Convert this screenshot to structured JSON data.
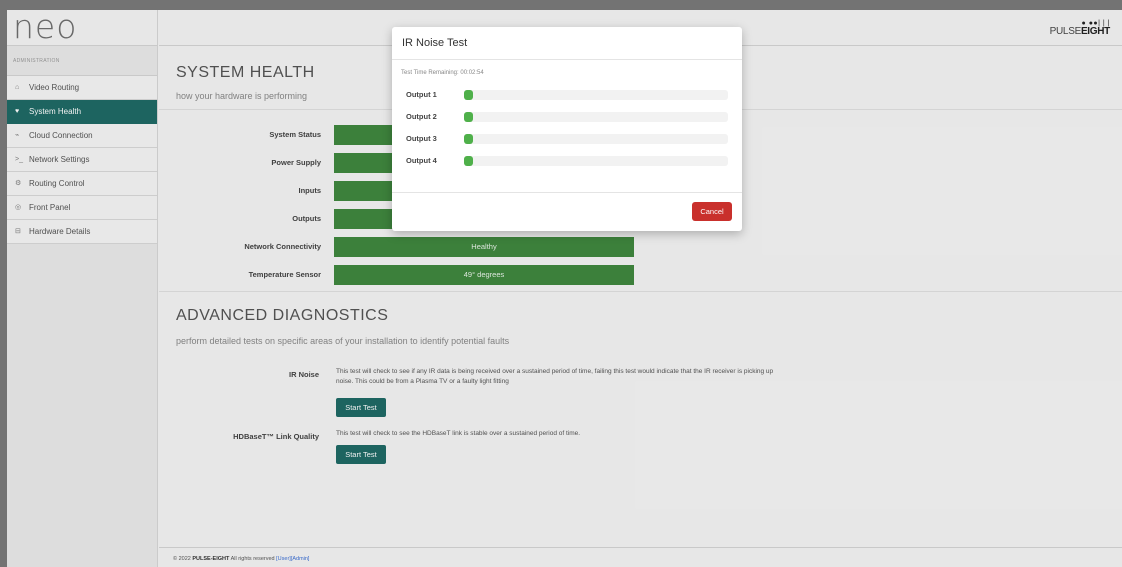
{
  "logo": "neo",
  "brand": {
    "mark": "● ●●| |  |",
    "name_light": "PULSE",
    "name_bold": "EIGHT"
  },
  "sidebar": {
    "section_label": "ADMINISTRATION",
    "items": [
      {
        "icon": "home-icon",
        "glyph": "⌂",
        "label": "Video Routing",
        "active": false
      },
      {
        "icon": "heart-icon",
        "glyph": "♥",
        "label": "System Health",
        "active": true
      },
      {
        "icon": "rss-icon",
        "glyph": "⌁",
        "label": "Cloud Connection",
        "active": false
      },
      {
        "icon": "terminal-icon",
        "glyph": ">_",
        "label": "Network Settings",
        "active": false
      },
      {
        "icon": "cogs-icon",
        "glyph": "⚙",
        "label": "Routing Control",
        "active": false
      },
      {
        "icon": "target-icon",
        "glyph": "◎",
        "label": "Front Panel",
        "active": false
      },
      {
        "icon": "drive-icon",
        "glyph": "⊟",
        "label": "Hardware Details",
        "active": false
      }
    ]
  },
  "health": {
    "title": "SYSTEM HEALTH",
    "subtitle": "how your hardware is performing",
    "rows": [
      {
        "label": "System Status",
        "value": ""
      },
      {
        "label": "Power Supply",
        "value": ""
      },
      {
        "label": "Inputs",
        "value": ""
      },
      {
        "label": "Outputs",
        "value": ""
      },
      {
        "label": "Network Connectivity",
        "value": "Healthy"
      },
      {
        "label": "Temperature Sensor",
        "value": "49° degrees"
      }
    ]
  },
  "diagnostics": {
    "title": "ADVANCED DIAGNOSTICS",
    "subtitle": "perform detailed tests on specific areas of your installation to identify potential faults",
    "tests": [
      {
        "label": "IR Noise",
        "description": "This test will check to see if any IR data is being received over a sustained period of time, failing this test would indicate that the IR receiver is picking up noise. This could be from a Plasma TV or a faulty light fitting",
        "button": "Start Test"
      },
      {
        "label": "HDBaseT™ Link Quality",
        "description": "This test will check to see the HDBaseT link is stable over a sustained period of time.",
        "button": "Start Test"
      }
    ]
  },
  "footer": {
    "copyright": "© 2022",
    "company": "PULSE-EIGHT",
    "rights": "All rights reserved",
    "user_link": "[User]",
    "admin_link": "[Admin]"
  },
  "modal": {
    "title": "IR Noise Test",
    "remaining_label": "Test Time Remaining: 00:02:54",
    "outputs": [
      {
        "label": "Output 1",
        "progress": 0.03
      },
      {
        "label": "Output 2",
        "progress": 0.03
      },
      {
        "label": "Output 3",
        "progress": 0.03
      },
      {
        "label": "Output 4",
        "progress": 0.03
      }
    ],
    "cancel_label": "Cancel"
  }
}
